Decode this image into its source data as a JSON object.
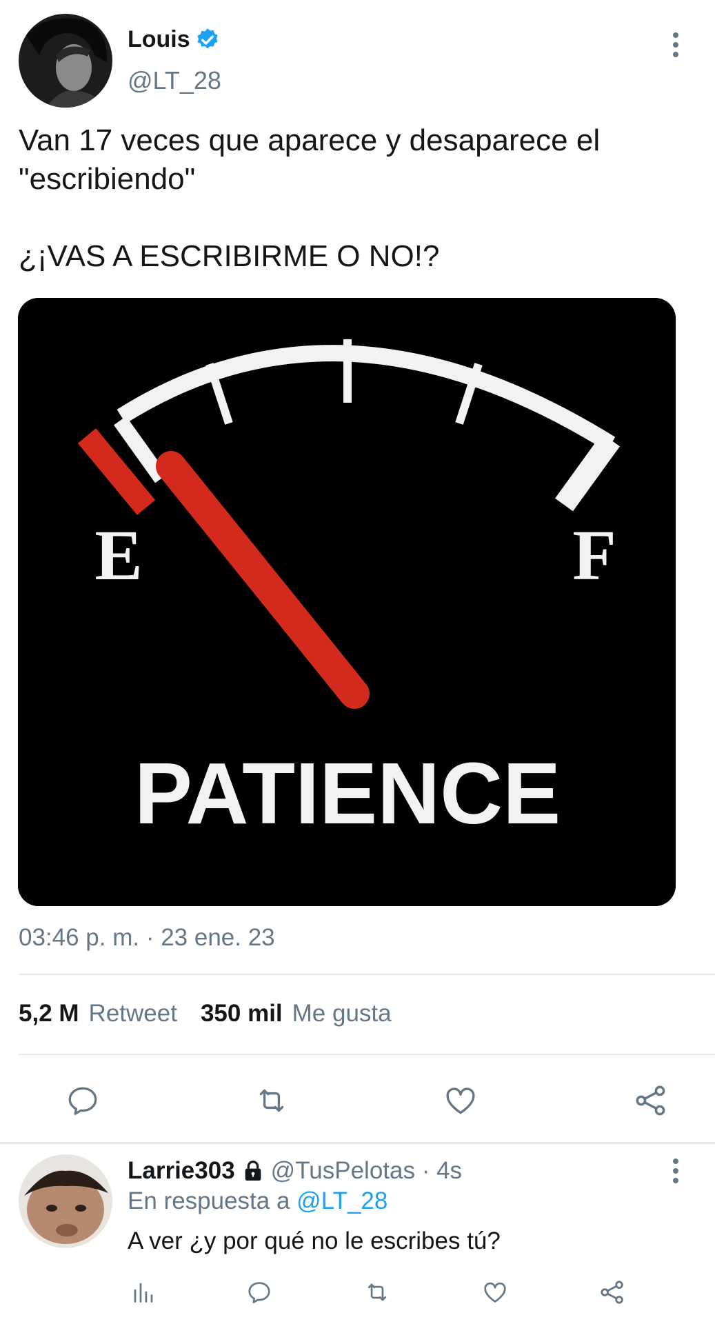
{
  "tweet": {
    "author": {
      "display_name": "Louis",
      "handle": "@LT_28",
      "verified": true
    },
    "text_line1": "Van 17 veces que aparece y desaparece el",
    "text_line2": "\"escribiendo\"",
    "text_line3": "¿¡VAS A ESCRIBIRME O NO!?",
    "media": {
      "gauge_label_empty": "E",
      "gauge_label_full": "F",
      "caption": "PATIENCE"
    },
    "timestamp": "03:46 p. m. · 23 ene. 23",
    "stats": {
      "retweets_count": "5,2 M",
      "retweets_label": "Retweet",
      "likes_count": "350 mil",
      "likes_label": "Me gusta"
    },
    "actions": [
      "reply-icon",
      "retweet-icon",
      "like-icon",
      "share-icon"
    ]
  },
  "reply": {
    "display_name": "Larrie303",
    "protected": true,
    "handle_time": "@TusPelotas · 4s",
    "in_reply_prefix": "En respuesta a",
    "in_reply_mention": "@LT_28",
    "text": "A ver ¿y por qué no le escribes tú?",
    "actions": [
      "analytics-icon",
      "reply-icon",
      "retweet-icon",
      "like-icon",
      "share-icon"
    ]
  },
  "colors": {
    "accent": "#1da1f2",
    "secondary_text": "#657786",
    "primary_text": "#14171a",
    "divider": "#e1e8ed",
    "needle": "#d42a1e"
  }
}
